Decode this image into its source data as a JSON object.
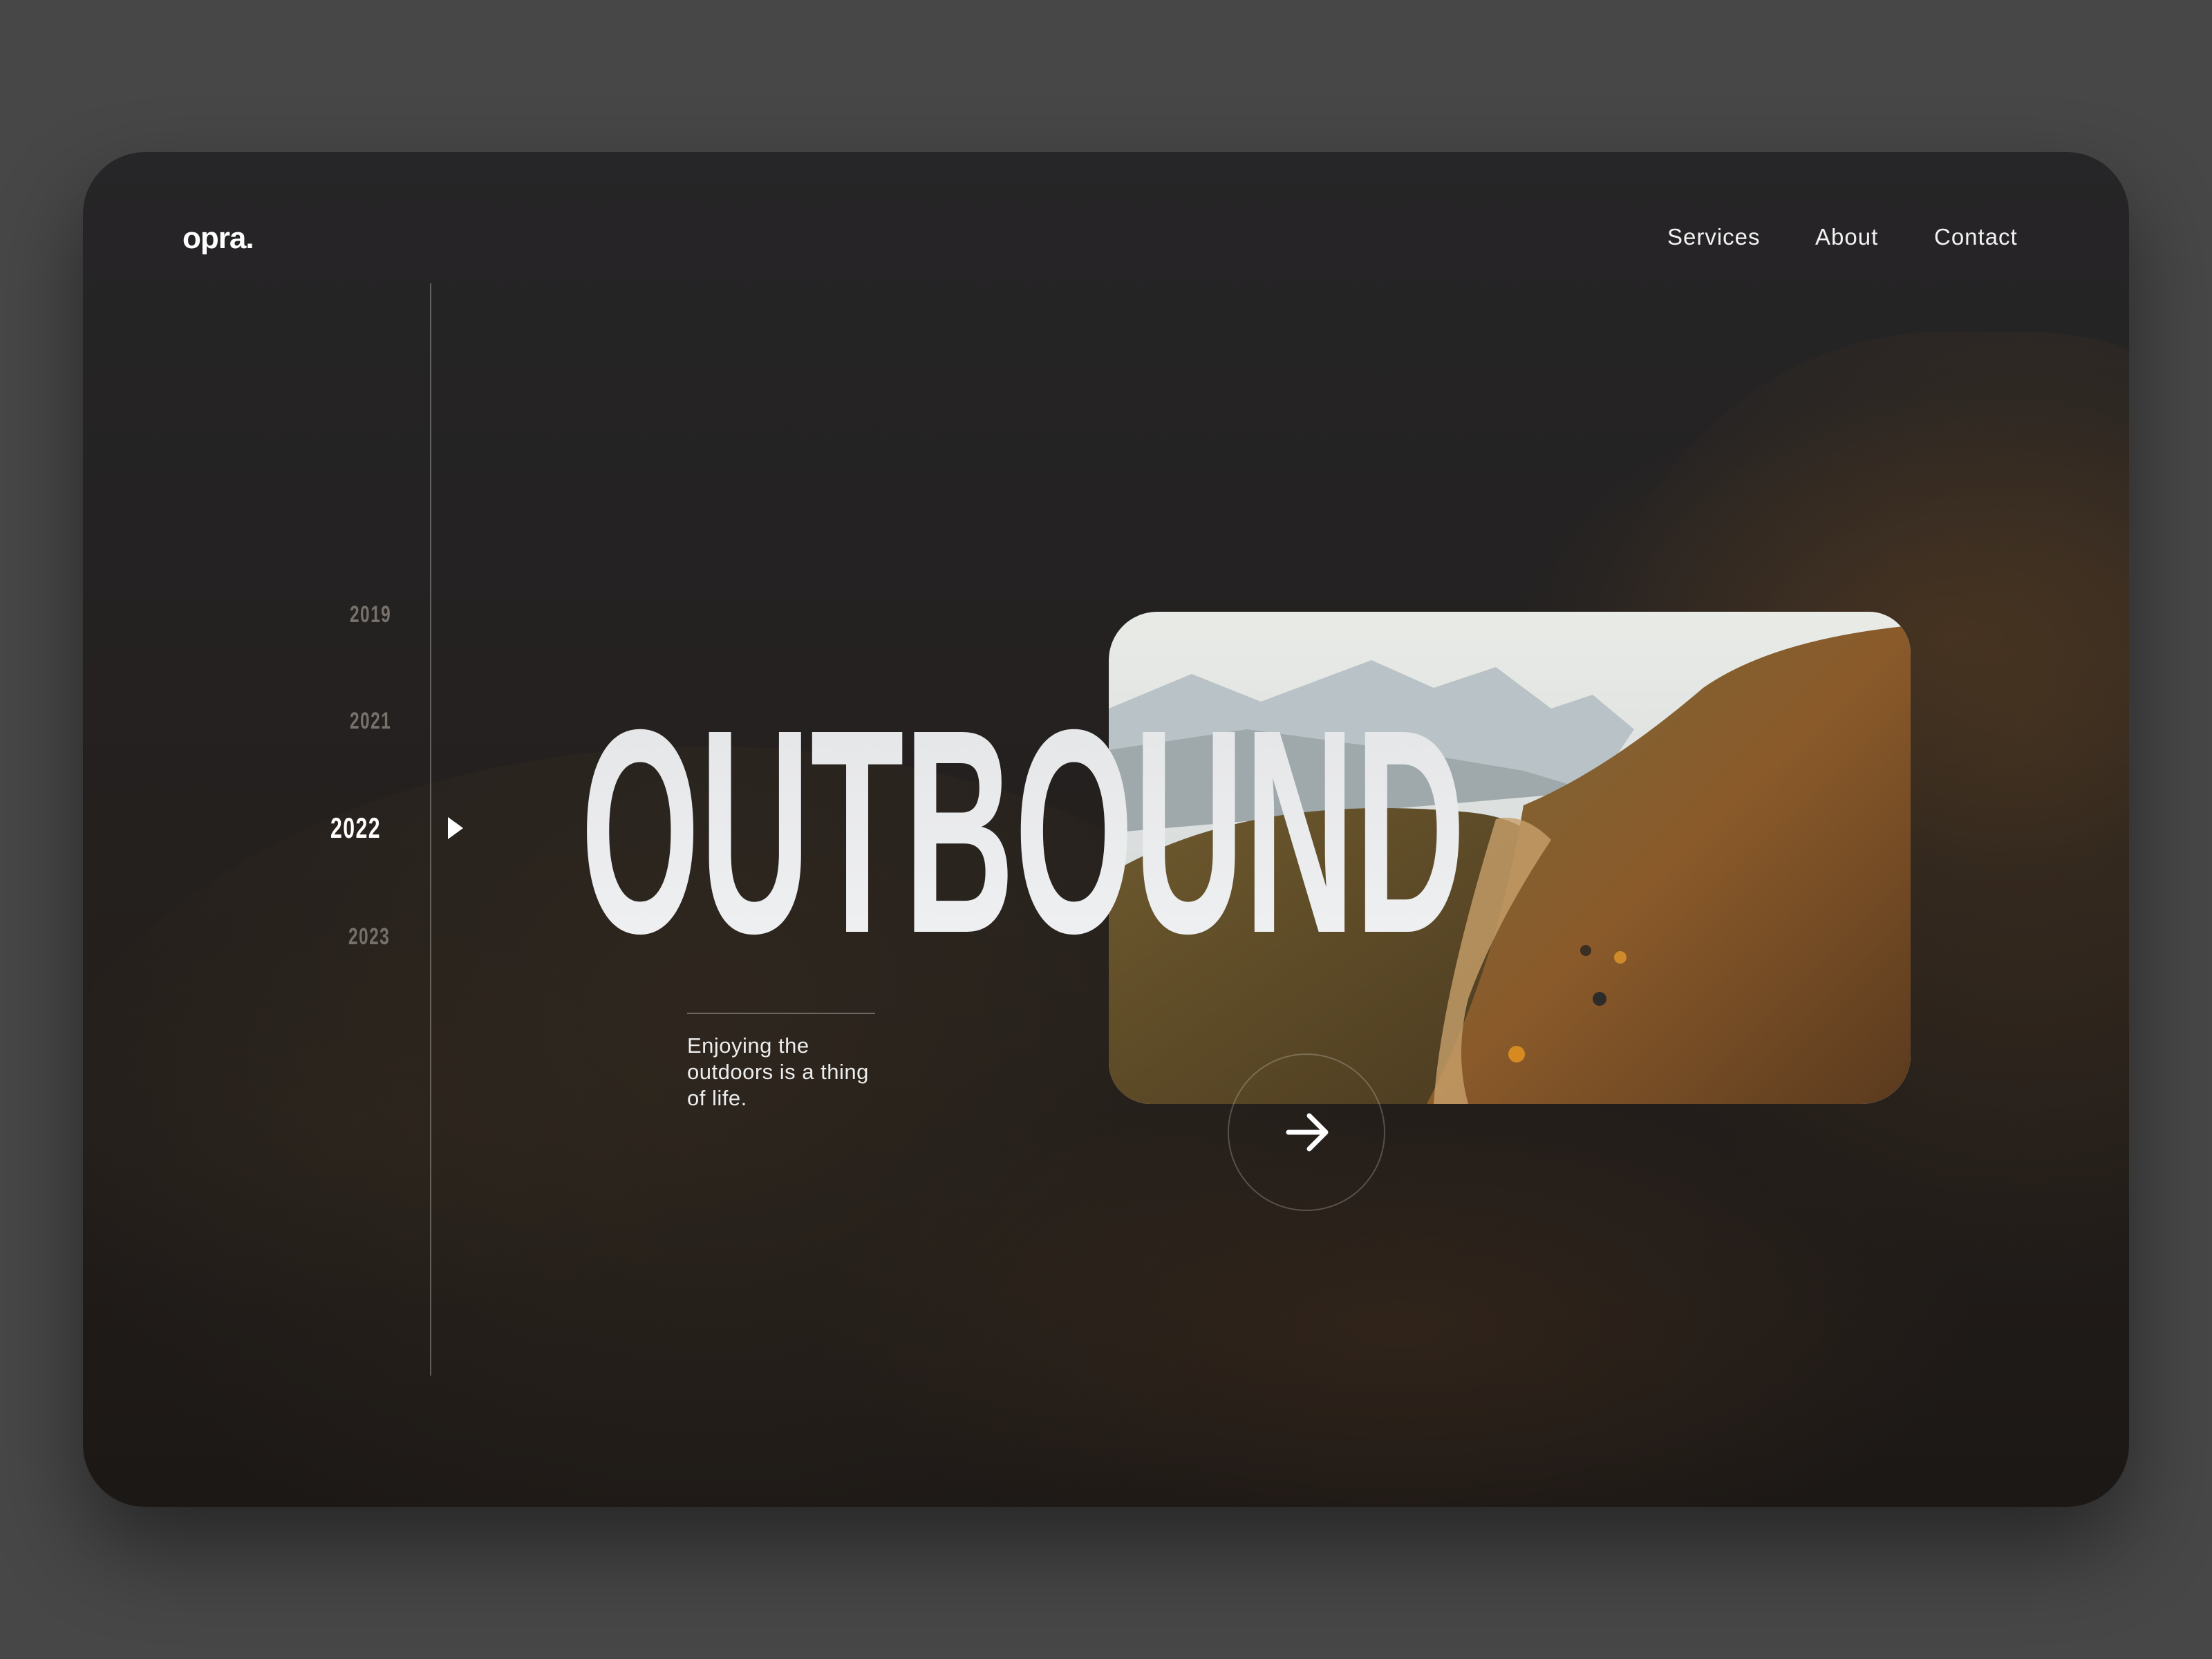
{
  "brand": {
    "logo": "opra."
  },
  "nav": [
    {
      "label": "Services"
    },
    {
      "label": "About"
    },
    {
      "label": "Contact"
    }
  ],
  "timeline": {
    "years": [
      "2019",
      "2021",
      "2022",
      "2023"
    ],
    "active": "2022"
  },
  "hero": {
    "headline": "OUTBOUND",
    "tagline_lines": [
      "Enjoying the",
      "outdoors is a thing",
      "of life."
    ]
  },
  "icons": {
    "next": "arrow-right-icon",
    "marker": "play-triangle-icon"
  },
  "colors": {
    "page_background": "#474747",
    "card_background": "#242222",
    "text_primary": "#ffffff",
    "year_inactive": "#77716c"
  }
}
